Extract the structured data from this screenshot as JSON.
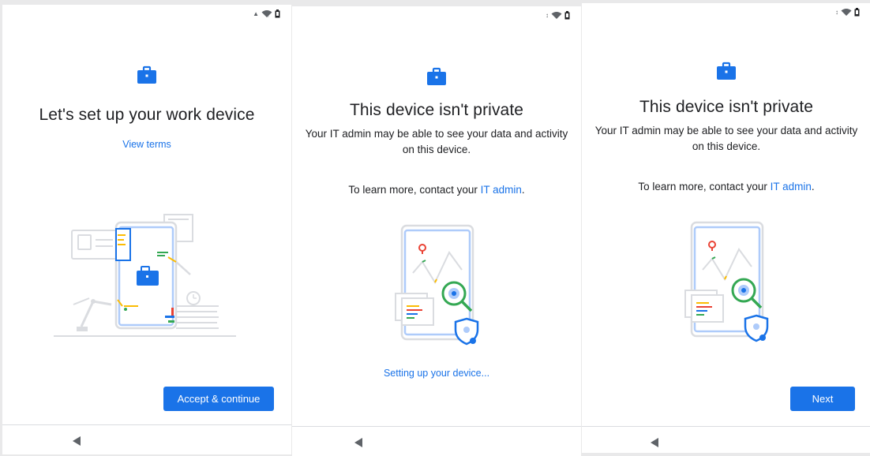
{
  "screens": [
    {
      "title": "Let's set up your work device",
      "view_terms": "View terms",
      "button": "Accept & continue",
      "icons": [
        "briefcase-icon",
        "wifi-icon",
        "battery-icon",
        "back-icon"
      ]
    },
    {
      "title": "This device isn't private",
      "description": "Your IT admin may be able to see your data and activity on this device.",
      "learn_prefix": "To learn more, contact your ",
      "learn_link": "IT admin",
      "learn_suffix": ".",
      "progress": "Setting up your device...",
      "icons": [
        "briefcase-icon",
        "wifi-icon",
        "battery-icon",
        "back-icon"
      ]
    },
    {
      "title": "This device isn't private",
      "description": "Your IT admin may be able to see your data and activity on this device.",
      "learn_prefix": "To learn more, contact your ",
      "learn_link": "IT admin",
      "learn_suffix": ".",
      "button": "Next",
      "icons": [
        "briefcase-icon",
        "wifi-icon",
        "battery-icon",
        "back-icon"
      ]
    }
  ],
  "colors": {
    "accent": "#1a73e8",
    "text": "#202124",
    "green": "#34a853",
    "red": "#ea4335",
    "yellow": "#fbbc04"
  }
}
